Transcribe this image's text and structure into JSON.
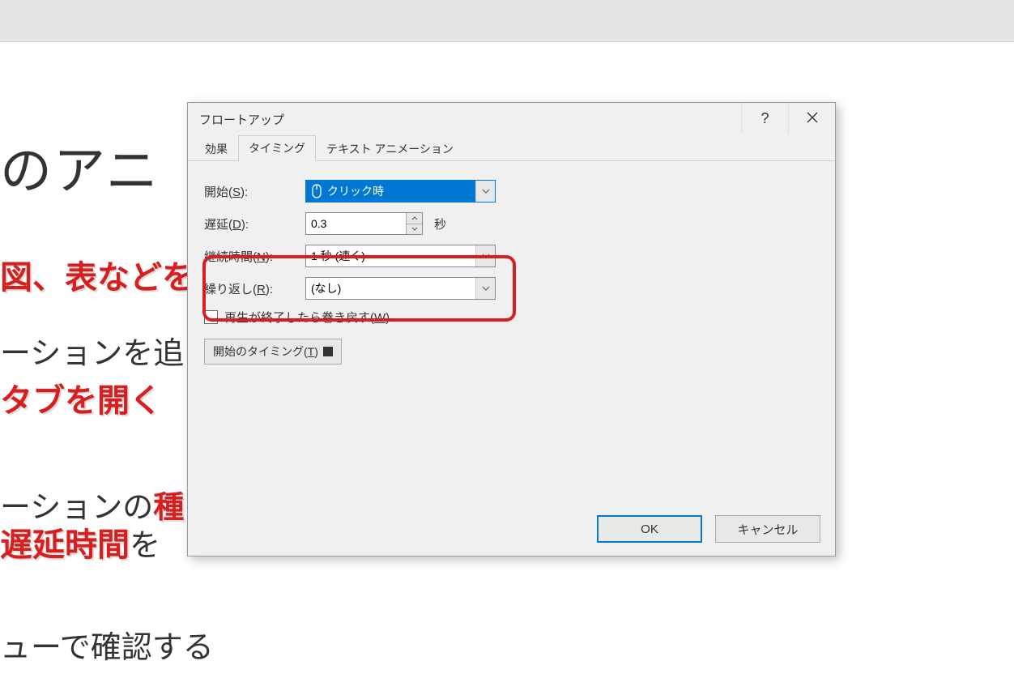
{
  "background": {
    "line1": "のアニ",
    "line2": "図、表などを",
    "line3": "ーションを追",
    "line4": "タブを開く",
    "line5_prefix": "ーションの",
    "line5_red": "種",
    "line6_red": "遅延時間",
    "line6_suffix": "を",
    "line7": "ューで確認する"
  },
  "dialog": {
    "title": "フロートアップ",
    "help_tooltip": "?",
    "tabs": {
      "effect": "効果",
      "timing": "タイミング",
      "text_animation": "テキスト アニメーション"
    },
    "fields": {
      "start": {
        "label_prefix": "開始(",
        "label_ul": "S",
        "label_suffix": "):",
        "value": "クリック時"
      },
      "delay": {
        "label_prefix": "遅延(",
        "label_ul": "D",
        "label_suffix": "):",
        "value": "0.3",
        "unit": "秒"
      },
      "duration": {
        "label_prefix": "継続時間(",
        "label_ul": "N",
        "label_suffix": "):",
        "value": "1 秒 (速く)"
      },
      "repeat": {
        "label_prefix": "繰り返し(",
        "label_ul": "R",
        "label_suffix": "):",
        "value": "(なし)"
      },
      "rewind": {
        "label_prefix": "再生が終了したら巻き戻す(",
        "label_ul": "W",
        "label_suffix": ")"
      },
      "trigger": {
        "label_prefix": "開始のタイミング(",
        "label_ul": "T",
        "label_suffix": ")"
      }
    },
    "buttons": {
      "ok": "OK",
      "cancel": "キャンセル"
    }
  }
}
